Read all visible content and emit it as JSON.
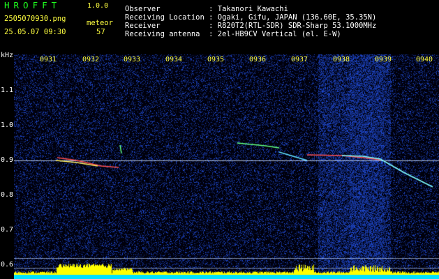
{
  "app": {
    "name": "HROFFT",
    "version": "1.0.0"
  },
  "file": {
    "name": "2505070930.png",
    "datetime": "25.05.07 09:30"
  },
  "meteor": {
    "label": "meteor",
    "count": "57"
  },
  "info": {
    "observer": "Observer           : Takanori Kawachi",
    "location": "Receiving Location : Ogaki, Gifu, JAPAN (136.60E, 35.35N)",
    "receiver": "Receiver           : R820T2(RTL-SDR) SDR-Sharp 53.1000MHz",
    "antenna": "Receiving antenna  : 2el-HB9CV Vertical (el. E-W)"
  },
  "yaxis": {
    "unit": "kHz",
    "ticks": [
      "1.1",
      "1.0",
      "0.9",
      "0.8",
      "0.7",
      "0.6"
    ]
  },
  "xaxis": {
    "ticks": [
      "0931",
      "0932",
      "0933",
      "0934",
      "0935",
      "0936",
      "0937",
      "0938",
      "0939",
      "0940"
    ]
  },
  "colors": {
    "header_app": "#20ff20",
    "header_file": "#ffff40",
    "noise": "#2040c0",
    "baseline": "#ffff00",
    "baseline_fill": "#00e0ff",
    "meteor_trail": "#ff4040"
  }
}
